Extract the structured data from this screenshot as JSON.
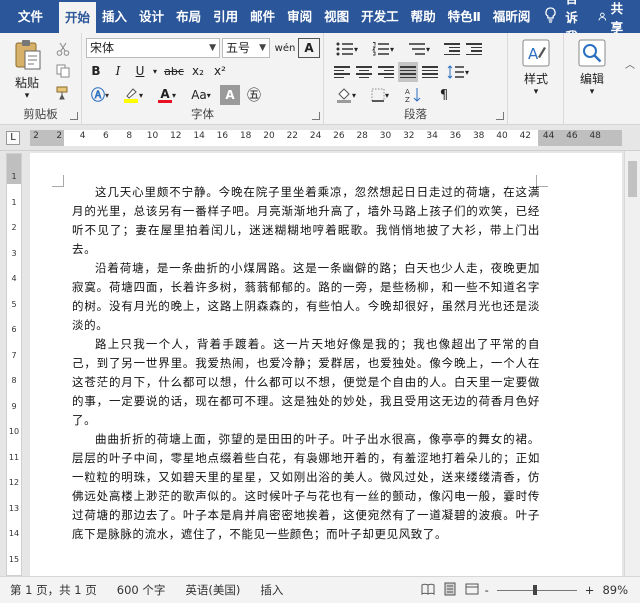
{
  "tabs": [
    "文件",
    "开始",
    "插入",
    "设计",
    "布局",
    "引用",
    "邮件",
    "审阅",
    "视图",
    "开发工",
    "帮助",
    "特色Ⅱ",
    "福昕阅"
  ],
  "tell_me": "告诉我",
  "share": "共享",
  "ribbon": {
    "clipboard": {
      "paste": "粘贴",
      "label": "剪贴板"
    },
    "font": {
      "name": "宋体",
      "size": "五号",
      "label": "字体",
      "buttons": {
        "bold": "B",
        "italic": "I",
        "underline": "U",
        "strike": "abc",
        "sub": "x₂",
        "sup": "x²",
        "font_color": "A",
        "phonetic": "wén",
        "char_border": "A",
        "aa": "Aa",
        "clear": "A"
      }
    },
    "paragraph": {
      "label": "段落"
    },
    "styles": {
      "label": "样式"
    },
    "editing": {
      "label": "编辑"
    }
  },
  "ruler": {
    "h": [
      "2",
      "2",
      "4",
      "6",
      "8",
      "10",
      "12",
      "14",
      "16",
      "18",
      "20",
      "22",
      "24",
      "26",
      "28",
      "30",
      "32",
      "34",
      "36",
      "38",
      "40",
      "42",
      "44",
      "46",
      "48"
    ],
    "v": [
      "1",
      "1",
      "2",
      "3",
      "4",
      "5",
      "6",
      "7",
      "8",
      "9",
      "10",
      "11",
      "12",
      "13",
      "14",
      "15"
    ]
  },
  "document": {
    "paragraphs": [
      "这几天心里颇不宁静。今晚在院子里坐着乘凉，忽然想起日日走过的荷塘，在这满月的光里，总该另有一番样子吧。月亮渐渐地升高了，墙外马路上孩子们的欢笑，已经听不见了；妻在屋里拍着闰儿，迷迷糊糊地哼着眠歌。我悄悄地披了大衫，带上门出去。",
      "沿着荷塘，是一条曲折的小煤屑路。这是一条幽僻的路；白天也少人走，夜晚更加寂寞。荷塘四面，长着许多树，蓊蓊郁郁的。路的一旁，是些杨柳，和一些不知道名字的树。没有月光的晚上，这路上阴森森的，有些怕人。今晚却很好，虽然月光也还是淡淡的。",
      "路上只我一个人，背着手踱着。这一片天地好像是我的；我也像超出了平常的自己，到了另一世界里。我爱热闹，也爱冷静；爱群居，也爱独处。像今晚上，一个人在这苍茫的月下，什么都可以想，什么都可以不想，便觉是个自由的人。白天里一定要做的事，一定要说的话，现在都可不理。这是独处的妙处，我且受用这无边的荷香月色好了。",
      "曲曲折折的荷塘上面，弥望的是田田的叶子。叶子出水很高，像亭亭的舞女的裙。层层的叶子中间，零星地点缀着些白花，有袅娜地开着的，有羞涩地打着朵儿的；正如一粒粒的明珠，又如碧天里的星星，又如刚出浴的美人。微风过处，送来缕缕清香，仿佛远处高楼上渺茫的歌声似的。这时候叶子与花也有一丝的颤动，像闪电一般，霎时传过荷塘的那边去了。叶子本是肩并肩密密地挨着，这便宛然有了一道凝碧的波痕。叶子底下是脉脉的流水，遮住了，不能见一些颜色；而叶子却更见风致了。"
    ]
  },
  "status": {
    "page": "第 1 页，共 1 页",
    "words": "600 个字",
    "lang": "英语(美国)",
    "mode": "插入",
    "zoom": "89%",
    "minus": "-",
    "plus": "+"
  }
}
